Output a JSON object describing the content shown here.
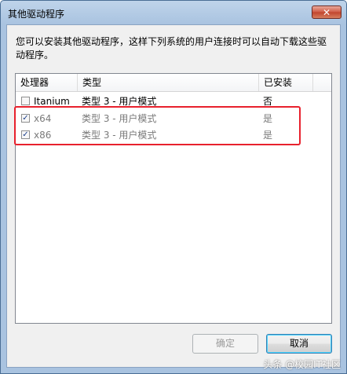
{
  "window": {
    "title": "其他驱动程序",
    "close_symbol": "✕"
  },
  "description": "您可以安装其他驱动程序，这样下列系统的用户连接时可以自动下载这些驱动程序。",
  "table": {
    "headers": [
      "处理器",
      "类型",
      "已安装"
    ],
    "rows": [
      {
        "processor": "Itanium",
        "type": "类型 3 - 用户模式",
        "installed": "否",
        "checked": false,
        "disabled": false
      },
      {
        "processor": "x64",
        "type": "类型 3 - 用户模式",
        "installed": "是",
        "checked": true,
        "disabled": true
      },
      {
        "processor": "x86",
        "type": "类型 3 - 用户模式",
        "installed": "是",
        "checked": true,
        "disabled": true
      }
    ]
  },
  "buttons": {
    "ok": "确定",
    "cancel": "取消"
  },
  "watermark": "头条 @校园IT社区",
  "colors": {
    "highlight_box": "#e8212d",
    "title_bar": "#a9c3e0"
  }
}
